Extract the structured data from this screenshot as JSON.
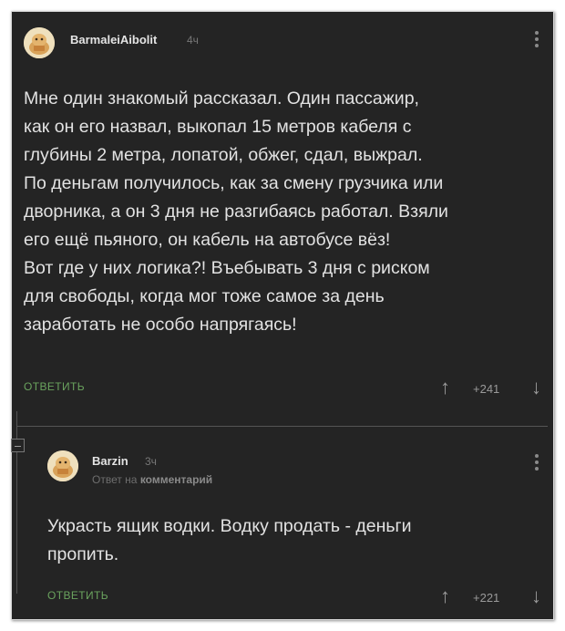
{
  "comments": [
    {
      "username": "BarmaleiAibolit",
      "time": "4ч",
      "avatar_icon": "hamster-avatar-icon",
      "lines": [
        "Мне один знакомый рассказал. Один пассажир,",
        "как он его назвал, выкопал 15 метров кабеля с",
        "глубины 2 метра, лопатой, обжег, сдал, выжрал.",
        "По деньгам получилось, как за смену грузчика или",
        "дворника, а он 3 дня не разгибаясь работал. Взяли",
        "его ещё пьяного, он кабель на автобусе вёз!",
        "Вот где у них логика?! Въебывать 3 дня с риском",
        "для свободы, когда мог тоже самое за день",
        "заработать не особо напрягаясь!"
      ],
      "reply_label": "ОТВЕТИТЬ",
      "score": "+241"
    },
    {
      "username": "Barzin",
      "time": "3ч",
      "avatar_icon": "hamster-avatar-icon",
      "reply_to_prefix": "Ответ на",
      "reply_to_target": "комментарий",
      "lines": [
        "Украсть ящик водки. Водку продать - деньги",
        "пропить."
      ],
      "reply_label": "ОТВЕТИТЬ",
      "score": "+221"
    }
  ],
  "icons": {
    "upvote": "↑",
    "downvote": "↓",
    "menu": "kebab-menu-icon",
    "collapse": "collapse-thread-icon"
  },
  "colors": {
    "background": "#242424",
    "text": "#e2e2e2",
    "reply_accent": "#6aa35e",
    "muted": "#9a9a9a"
  }
}
